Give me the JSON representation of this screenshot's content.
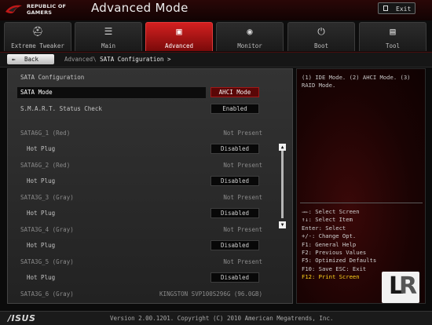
{
  "header": {
    "brand_line1": "REPUBLIC OF",
    "brand_line2": "GAMERS",
    "title": "Advanced Mode",
    "exit_label": "Exit"
  },
  "tabs": [
    {
      "label": "Extreme Tweaker",
      "icon": "helmet-icon",
      "glyph": "⛑"
    },
    {
      "label": "Main",
      "icon": "list-icon",
      "glyph": "☰"
    },
    {
      "label": "Advanced",
      "icon": "chip-icon",
      "glyph": "▣"
    },
    {
      "label": "Monitor",
      "icon": "gauge-icon",
      "glyph": "◉"
    },
    {
      "label": "Boot",
      "icon": "power-icon",
      "glyph": "⏻"
    },
    {
      "label": "Tool",
      "icon": "tool-icon",
      "glyph": "▤"
    }
  ],
  "breadcrumb": {
    "back_label": "Back",
    "path_prefix": "Advanced\\",
    "current": "SATA Configuration >"
  },
  "main": {
    "section_title": "SATA Configuration",
    "rows": [
      {
        "label": "SATA Mode",
        "value": "AHCI Mode"
      },
      {
        "label": "S.M.A.R.T. Status Check",
        "value": "Enabled"
      },
      {
        "label": "SATA6G_1 (Red)",
        "status": "Not Present"
      },
      {
        "label": "Hot Plug",
        "value": "Disabled"
      },
      {
        "label": "SATA6G_2 (Red)",
        "status": "Not Present"
      },
      {
        "label": "Hot Plug",
        "value": "Disabled"
      },
      {
        "label": "SATA3G_3 (Gray)",
        "status": "Not Present"
      },
      {
        "label": "Hot Plug",
        "value": "Disabled"
      },
      {
        "label": "SATA3G_4 (Gray)",
        "status": "Not Present"
      },
      {
        "label": "Hot Plug",
        "value": "Disabled"
      },
      {
        "label": "SATA3G_5 (Gray)",
        "status": "Not Present"
      },
      {
        "label": "Hot Plug",
        "value": "Disabled"
      },
      {
        "label": "SATA3G_6 (Gray)",
        "status": "KINGSTON SVP100S296G (96.0GB)"
      }
    ]
  },
  "help": {
    "description": "(1) IDE Mode. (2) AHCI Mode. (3) RAID Mode.",
    "keys": [
      "→←: Select Screen",
      "↑↓: Select Item",
      "Enter: Select",
      "+/-: Change Opt.",
      "F1: General Help",
      "F2: Previous Values",
      "F5: Optimized Defaults",
      "F10: Save  ESC: Exit",
      "F12: Print Screen"
    ],
    "badge_l": "L",
    "badge_r": "R"
  },
  "footer": {
    "brand": "/ISUS",
    "version": "Version 2.00.1201. Copyright (C) 2010 American Megatrends, Inc."
  },
  "colors": {
    "accent": "#d42020",
    "highlight_key": "#ffd21a",
    "selected_value_bg": "#5a0707"
  }
}
